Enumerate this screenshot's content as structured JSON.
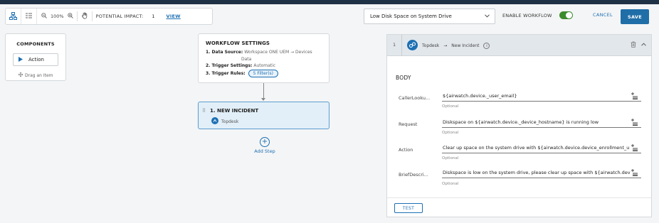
{
  "toolbar": {
    "zoom_level": "100%",
    "impact_label": "POTENTIAL IMPACT:",
    "impact_count": "1",
    "view_label": "VIEW"
  },
  "header": {
    "workflow_name": "Low Disk Space on System Drive",
    "enable_label": "ENABLE WORKFLOW",
    "enable_on": true,
    "cancel_label": "CANCEL",
    "save_label": "SAVE"
  },
  "components": {
    "title": "COMPONENTS",
    "action_label": "Action",
    "drag_hint": "Drag an Item"
  },
  "workflow_settings": {
    "title": "WORKFLOW SETTINGS",
    "data_source_label": "1. Data Source:",
    "data_source_value": "Workspace ONE UEM → Devices",
    "data_source_value_cont": "Data",
    "trigger_settings_label": "2. Trigger Settings:",
    "trigger_settings_value": "Automatic",
    "trigger_rules_label": "3. Trigger Rules:",
    "trigger_rules_value": "5 Filter(s)"
  },
  "step": {
    "title": "1. NEW INCIDENT",
    "source": "Topdesk"
  },
  "add_step_label": "Add Step",
  "panel": {
    "step_number": "1",
    "connector": "Topdesk",
    "arrow": "→",
    "action": "New Incident",
    "info_glyph": "i",
    "body_title": "BODY",
    "optional_label": "Optional",
    "fields": [
      {
        "label": "CallerLooku...",
        "value": "${airwatch.device._user_email}"
      },
      {
        "label": "Request",
        "value": "Diskspace on ${airwatch.device._device_hostname} is running low"
      },
      {
        "label": "Action",
        "value": "Clear up space on the system drive with ${airwatch.device.device_enrollment_u"
      },
      {
        "label": "BriefDescri...",
        "value": "Diskspace is low on the system drive, please clear up space with ${airwatch.dev"
      }
    ],
    "test_label": "TEST"
  },
  "colors": {
    "accent": "#1c6fb3",
    "save_bg": "#1f6ea8",
    "toggle_on": "#3d8b2f",
    "selected_card": "#e2eff8",
    "top_bar": "#1f3145"
  },
  "icons": [
    "workflow-view-icon",
    "list-view-icon",
    "zoom-out-icon",
    "zoom-in-icon",
    "pan-hand-icon",
    "chevron-down-icon",
    "play-icon",
    "drag-handle-icon",
    "topdesk-logo-icon",
    "info-icon",
    "trash-icon",
    "chevron-up-icon",
    "insert-variable-icon",
    "add-circle-icon"
  ]
}
